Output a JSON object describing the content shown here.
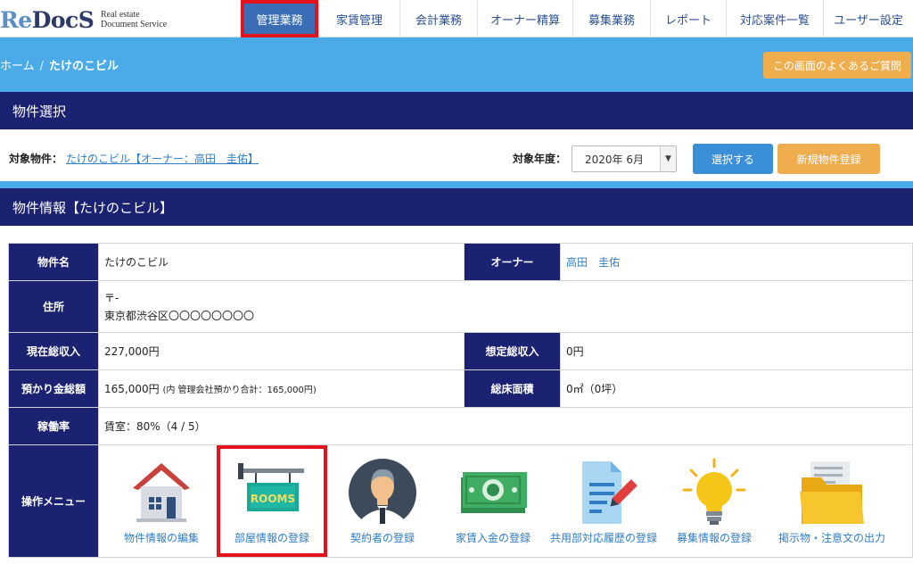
{
  "brand": {
    "logo_prefix": "Re",
    "logo_suffix": "DocS",
    "tagline_line1": "Real estate",
    "tagline_line2": "Document Service"
  },
  "nav": {
    "items": [
      {
        "label": "管理業務",
        "active": true
      },
      {
        "label": "家賃管理"
      },
      {
        "label": "会計業務"
      },
      {
        "label": "オーナー精算"
      },
      {
        "label": "募集業務"
      },
      {
        "label": "レポート"
      },
      {
        "label": "対応案件一覧"
      },
      {
        "label": "ユーザー設定"
      }
    ]
  },
  "breadcrumb": {
    "home": "ホーム",
    "separator": "/",
    "current": "たけのこビル"
  },
  "faq_button": "この画面のよくあるご質問",
  "property_select": {
    "section_title": "物件選択",
    "target_label": "対象物件：",
    "target_value": "たけのこビル【オーナー：高田　圭佑】",
    "year_label": "対象年度：",
    "year_value": "2020年 6月",
    "select_button": "選択する",
    "new_button": "新規物件登録"
  },
  "property_info": {
    "section_title": "物件情報【たけのこビル】",
    "name_label": "物件名",
    "name_value": "たけのこビル",
    "owner_label": "オーナー",
    "owner_value": "高田　圭佑",
    "address_label": "住所",
    "address_line1": "〒-",
    "address_line2": "東京都渋谷区〇〇〇〇〇〇〇〇",
    "income_label": "現在総収入",
    "income_value": "227,000円",
    "expected_income_label": "想定総収入",
    "expected_income_value": "0円",
    "deposit_label": "預かり金総額",
    "deposit_value": "165,000円",
    "deposit_note": "(内 管理会社預かり合計：165,000円)",
    "floor_label": "総床面積",
    "floor_value": "0㎡（0坪）",
    "occupancy_label": "稼働率",
    "occupancy_value": "賃室：80%（4 / 5）",
    "menu_label": "操作メニュー"
  },
  "menu": [
    {
      "label": "物件情報の編集",
      "icon": "house-icon"
    },
    {
      "label": "部屋情報の登録",
      "icon": "rooms-sign-icon",
      "highlighted": true
    },
    {
      "label": "契約者の登録",
      "icon": "person-icon"
    },
    {
      "label": "家賃入金の登録",
      "icon": "money-icon"
    },
    {
      "label": "共用部対応履歴の登録",
      "icon": "document-pen-icon"
    },
    {
      "label": "募集情報の登録",
      "icon": "lightbulb-icon"
    },
    {
      "label": "掲示物・注意文の出力",
      "icon": "folder-icon"
    }
  ],
  "colors": {
    "navy": "#1c2272",
    "sky": "#4aabe8",
    "link": "#2f7dc4",
    "orange": "#f0ad4e",
    "highlight": "#e3121b"
  }
}
